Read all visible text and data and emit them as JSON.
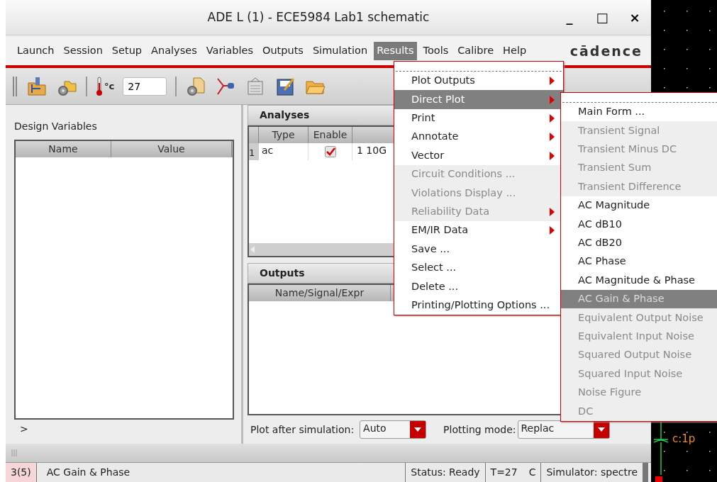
{
  "window": {
    "title": "ADE L (1) - ECE5984 Lab1 schematic",
    "controls": [
      "_",
      "□",
      "×"
    ]
  },
  "menubar": [
    {
      "label": "Launch",
      "selected": false
    },
    {
      "label": "Session",
      "selected": false
    },
    {
      "label": "Setup",
      "selected": false
    },
    {
      "label": "Analyses",
      "selected": false
    },
    {
      "label": "Variables",
      "selected": false
    },
    {
      "label": "Outputs",
      "selected": false
    },
    {
      "label": "Simulation",
      "selected": false
    },
    {
      "label": "Results",
      "selected": true
    },
    {
      "label": "Tools",
      "selected": false
    },
    {
      "label": "Calibre",
      "selected": false
    },
    {
      "label": "Help",
      "selected": false
    }
  ],
  "brand": "cādence",
  "toolbar": {
    "temperature_unit": "°c",
    "temperature": "27"
  },
  "design_variables": {
    "title": "Design Variables",
    "columns": [
      "Name",
      "Value"
    ],
    "expand": ">"
  },
  "analyses": {
    "title": "Analyses",
    "columns": [
      "Type",
      "Enable"
    ],
    "rows": [
      {
        "number": "1",
        "type": "ac",
        "enabled": true,
        "column_3": "1 10G"
      }
    ]
  },
  "outputs": {
    "title": "Outputs",
    "columns": [
      "Name/Signal/Expr"
    ]
  },
  "plot_options": {
    "plot_after_label": "Plot after simulation:",
    "plot_after": "Auto",
    "mode_label": "Plotting mode:",
    "mode": "Replac"
  },
  "results_menu": [
    {
      "label": "Plot Outputs",
      "disabled": false,
      "submenu": true,
      "selected": false
    },
    {
      "label": "Direct Plot",
      "disabled": false,
      "submenu": true,
      "selected": true
    },
    {
      "label": "Print",
      "disabled": false,
      "submenu": true,
      "selected": false
    },
    {
      "label": "Annotate",
      "disabled": false,
      "submenu": true,
      "selected": false
    },
    {
      "label": "Vector",
      "disabled": false,
      "submenu": true,
      "selected": false
    },
    {
      "label": "Circuit Conditions ...",
      "disabled": true,
      "submenu": false,
      "selected": false
    },
    {
      "label": "Violations Display ...",
      "disabled": true,
      "submenu": false,
      "selected": false
    },
    {
      "label": "Reliability Data",
      "disabled": true,
      "submenu": true,
      "selected": false
    },
    {
      "label": "EM/IR Data",
      "disabled": false,
      "submenu": true,
      "selected": false
    },
    {
      "label": "Save ...",
      "disabled": false,
      "submenu": false,
      "selected": false
    },
    {
      "label": "Select ...",
      "disabled": false,
      "submenu": false,
      "selected": false
    },
    {
      "label": "Delete ...",
      "disabled": false,
      "submenu": false,
      "selected": false
    },
    {
      "label": "Printing/Plotting Options ...",
      "disabled": false,
      "submenu": false,
      "selected": false
    }
  ],
  "direct_plot_menu": [
    {
      "label": "Main Form ...",
      "disabled": false,
      "selected": false
    },
    {
      "label": "Transient Signal",
      "disabled": true,
      "selected": false
    },
    {
      "label": "Transient Minus DC",
      "disabled": true,
      "selected": false
    },
    {
      "label": "Transient Sum",
      "disabled": true,
      "selected": false
    },
    {
      "label": "Transient Difference",
      "disabled": true,
      "selected": false
    },
    {
      "label": "AC Magnitude",
      "disabled": false,
      "selected": false
    },
    {
      "label": "AC dB10",
      "disabled": false,
      "selected": false
    },
    {
      "label": "AC dB20",
      "disabled": false,
      "selected": false
    },
    {
      "label": "AC Phase",
      "disabled": false,
      "selected": false
    },
    {
      "label": "AC Magnitude & Phase",
      "disabled": false,
      "selected": false
    },
    {
      "label": "AC Gain & Phase",
      "disabled": true,
      "selected": true
    },
    {
      "label": "Equivalent Output Noise",
      "disabled": true,
      "selected": false
    },
    {
      "label": "Equivalent Input Noise",
      "disabled": true,
      "selected": false
    },
    {
      "label": "Squared Output Noise",
      "disabled": true,
      "selected": false
    },
    {
      "label": "Squared Input Noise",
      "disabled": true,
      "selected": false
    },
    {
      "label": "Noise Figure",
      "disabled": true,
      "selected": false
    },
    {
      "label": "DC",
      "disabled": true,
      "selected": false
    }
  ],
  "status_bar": {
    "history": "3(5)",
    "message": "AC Gain & Phase",
    "status": "Status: Ready",
    "temperature": "T=27",
    "unit": "C",
    "simulator": "Simulator: spectre"
  },
  "schematic": {
    "label": "c:1p"
  }
}
